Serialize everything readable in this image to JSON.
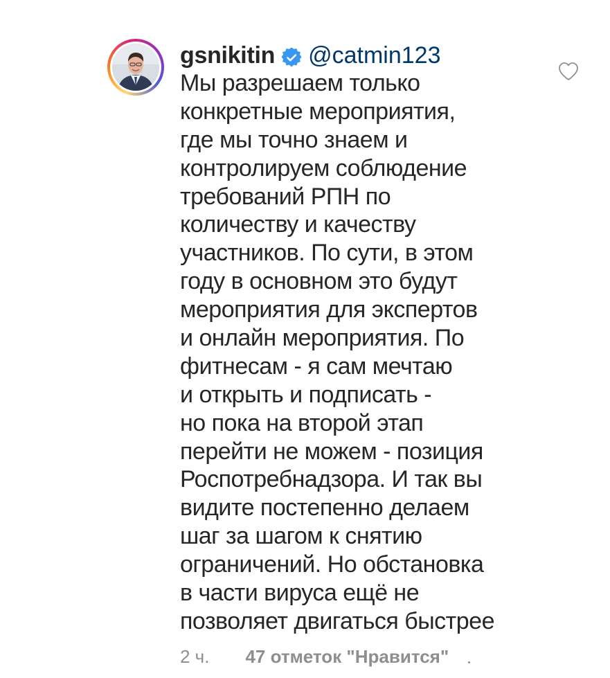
{
  "comment": {
    "username": "gsnikitin",
    "verified_icon": "verified-badge-icon",
    "mention": "@catmin123",
    "lines": [
      "Мы разрешаем только",
      "конкретные мероприятия,",
      "где мы точно знаем и",
      "контролируем соблюдение",
      "требований РПН по",
      "количеству и качеству",
      "участников. По сути, в этом",
      "году в основном это будут",
      "мероприятия для экспертов",
      "и онлайн мероприятия. По",
      "фитнесам - я сам мечтаю",
      "и открыть и подписать -",
      "но пока на второй этап",
      "перейти не можем - позиция",
      "Роспотребнадзора. И так вы",
      "видите постепенно делаем",
      "шаг за шагом к снятию",
      "ограничений. Но обстановка",
      "в части вируса ещё не",
      "позволяет двигаться быстрее"
    ],
    "time": "2 ч.",
    "likes": "47 отметок \"Нравится\"",
    "like_icon": "heart-outline-icon"
  },
  "colors": {
    "text": "#262626",
    "mention": "#00376b",
    "meta": "#8e8e8e",
    "verified": "#3897f0"
  }
}
